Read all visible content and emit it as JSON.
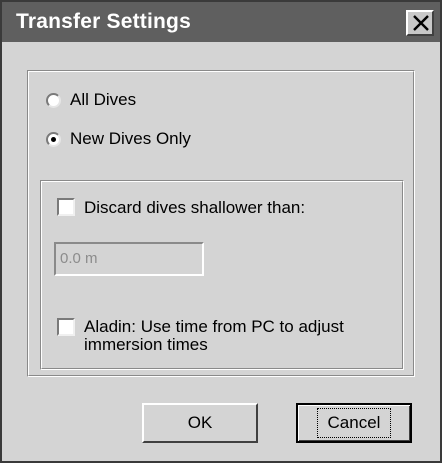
{
  "window": {
    "title": "Transfer Settings",
    "close_icon": "close-x-icon"
  },
  "transfer_mode": {
    "options": [
      {
        "label": "All Dives",
        "checked": false
      },
      {
        "label": "New Dives Only",
        "checked": true
      }
    ]
  },
  "filters": {
    "discard_label": "Discard dives shallower than:",
    "discard_checked": false,
    "depth_value": "0.0 m",
    "aladin_label_line1": "Aladin: Use time from PC to adjust",
    "aladin_label_line2": "immersion times",
    "aladin_checked": false
  },
  "buttons": {
    "ok": "OK",
    "cancel": "Cancel"
  },
  "colors": {
    "titlebar": "#5f5f5f",
    "dialog_bg": "#d4d4d4"
  }
}
